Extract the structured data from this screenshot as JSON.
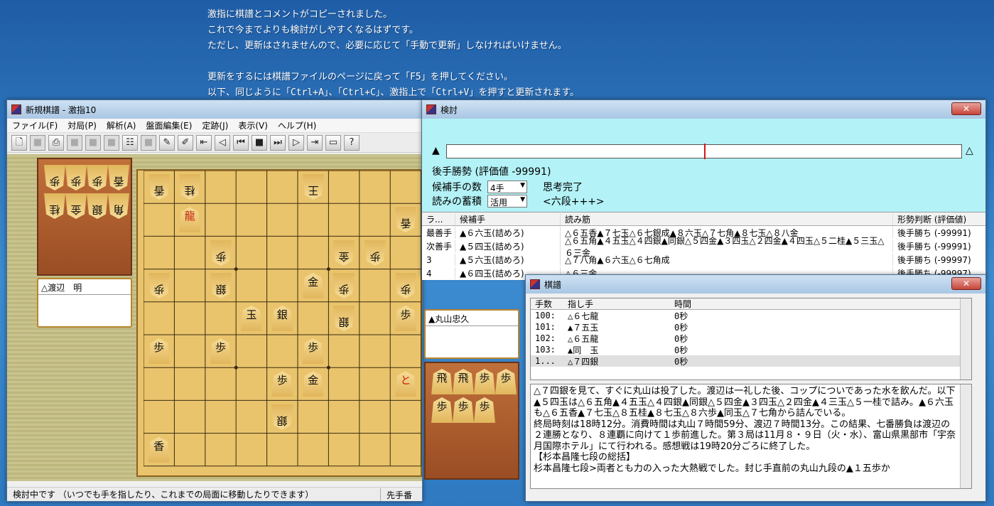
{
  "desktop": {
    "notice": [
      "激指に棋譜とコメントがコピーされました。",
      "これで今までよりも検討がしやすくなるはずです。",
      "ただし、更新はされませんので、必要に応じて「手動で更新」しなければいけません。",
      "",
      "更新をするには棋譜ファイルのページに戻って「F5」を押してください。",
      "以下、同じように「Ctrl+A」、「Ctrl+C」、激指上で「Ctrl+V」を押すと更新されます。"
    ]
  },
  "main": {
    "title": "新規棋譜 - 激指10",
    "menu": [
      "ファイル(F)",
      "対局(P)",
      "解析(A)",
      "盤面編集(E)",
      "定跡(J)",
      "表示(V)",
      "ヘルプ(H)"
    ],
    "gote_name": "△渡辺　明",
    "sente_name": "▲丸山忠久",
    "status_text": "検討中です （いつでも手を指したり、これまでの局面に移動したりできます）",
    "status_turn": "先手番"
  },
  "board": {
    "pieces": [
      {
        "c": 9,
        "r": 1,
        "t": "香",
        "g": true
      },
      {
        "c": 8,
        "r": 1,
        "t": "桂",
        "g": true
      },
      {
        "c": 4,
        "r": 1,
        "t": "王",
        "g": true
      },
      {
        "c": 8,
        "r": 2,
        "t": "龍",
        "g": false,
        "red": true
      },
      {
        "c": 1,
        "r": 2,
        "t": "香",
        "g": true
      },
      {
        "c": 7,
        "r": 3,
        "t": "歩",
        "g": true
      },
      {
        "c": 3,
        "r": 3,
        "t": "金",
        "g": true
      },
      {
        "c": 2,
        "r": 3,
        "t": "歩",
        "g": true
      },
      {
        "c": 9,
        "r": 4,
        "t": "歩",
        "g": true
      },
      {
        "c": 7,
        "r": 4,
        "t": "銀",
        "g": true
      },
      {
        "c": 4,
        "r": 4,
        "t": "金",
        "g": false
      },
      {
        "c": 3,
        "r": 4,
        "t": "歩",
        "g": true
      },
      {
        "c": 1,
        "r": 4,
        "t": "歩",
        "g": true
      },
      {
        "c": 6,
        "r": 5,
        "t": "玉",
        "g": false
      },
      {
        "c": 5,
        "r": 5,
        "t": "銀",
        "g": false
      },
      {
        "c": 3,
        "r": 5,
        "t": "銀",
        "g": true
      },
      {
        "c": 1,
        "r": 5,
        "t": "歩",
        "g": false
      },
      {
        "c": 9,
        "r": 6,
        "t": "歩",
        "g": false
      },
      {
        "c": 7,
        "r": 6,
        "t": "歩",
        "g": false
      },
      {
        "c": 4,
        "r": 6,
        "t": "歩",
        "g": false
      },
      {
        "c": 5,
        "r": 7,
        "t": "歩",
        "g": false
      },
      {
        "c": 4,
        "r": 7,
        "t": "金",
        "g": false
      },
      {
        "c": 1,
        "r": 7,
        "t": "と",
        "g": false,
        "red": true
      },
      {
        "c": 5,
        "r": 8,
        "t": "銀",
        "g": true
      },
      {
        "c": 9,
        "r": 9,
        "t": "香",
        "g": false
      }
    ],
    "gote_hand": [
      "歩",
      "歩",
      "歩",
      "香",
      "桂",
      "金",
      "銀",
      "角"
    ],
    "sente_hand": [
      "飛",
      "飛",
      "歩",
      "歩",
      "歩",
      "歩",
      "歩"
    ]
  },
  "analysis": {
    "title": "検討",
    "eval_text": "後手勝勢 (評価値 -99991)",
    "cand_label": "候補手の数",
    "cand_value": "4手",
    "think_status": "思考完了",
    "read_label": "読みの蓄積",
    "read_value": "活用",
    "level": "<六段+++>",
    "eval_marker_pct": 50,
    "headers": [
      "ラ...",
      "候補手",
      "読み筋",
      "形勢判断 (評価値)"
    ],
    "rows": [
      {
        "rank": "最善手",
        "move": "▲６六玉(詰めろ)",
        "pv": "△６五香▲７七玉△６七銀成▲８六玉△７七角▲８七玉△８八金",
        "judge": "後手勝ち (-99991)"
      },
      {
        "rank": "次善手",
        "move": "▲５四玉(詰めろ)",
        "pv": "△６五角▲４五玉△４四銀▲同銀△５四金▲３四玉△２四金▲４四玉△５二桂▲５三玉△６三金",
        "judge": "後手勝ち (-99991)"
      },
      {
        "rank": "3",
        "move": "▲５六玉(詰めろ)",
        "pv": "△７八角▲６六玉△６七角成",
        "judge": "後手勝ち (-99997)"
      },
      {
        "rank": "4",
        "move": "▲６四玉(詰めろ)",
        "pv": "△６三金",
        "judge": "後手勝ち (-99997)"
      }
    ]
  },
  "kifu": {
    "title": "棋譜",
    "headers": [
      "手数",
      "指し手",
      "時間"
    ],
    "rows": [
      {
        "n": "100:",
        "m": "△６七龍",
        "t": "0秒"
      },
      {
        "n": "101:",
        "m": "▲７五玉",
        "t": "0秒"
      },
      {
        "n": "102:",
        "m": "△６五龍",
        "t": "0秒"
      },
      {
        "n": "103:",
        "m": "▲同　玉",
        "t": "0秒"
      },
      {
        "n": "1...",
        "m": "△７四銀",
        "t": "0秒"
      }
    ],
    "comment": "△７四銀を見て、すぐに丸山は投了した。渡辺は一礼した後、コップについであった水を飲んだ。以下▲５四玉は△６五角▲４五玉△４四銀▲同銀△５四金▲３四玉△２四金▲４三玉△５一桂で詰み。▲６六玉も△６五香▲７七玉△８五桂▲８七玉△８六歩▲同玉△７七角から詰んでいる。\n終局時刻は18時12分。消費時間は丸山７時間59分、渡辺７時間13分。この結果、七番勝負は渡辺の２連勝となり、８連覇に向けて１歩前進した。第３局は11月８・９日（火・水）、富山県黒部市「宇奈月国際ホテル」にて行われる。感想戦は19時20分ごろに終了した。\n【杉本昌隆七段の総括】\n杉本昌隆七段>両者とも力の入った大熱戦でした。封じ手直前の丸山九段の▲１五歩か"
  }
}
